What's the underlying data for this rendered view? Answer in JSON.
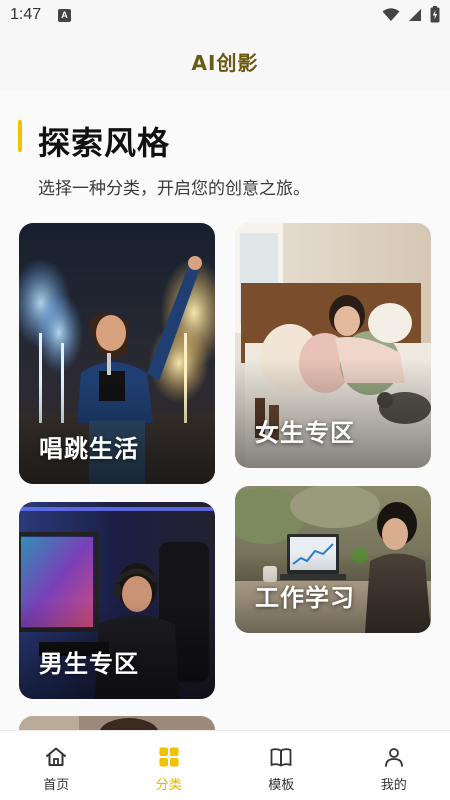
{
  "status": {
    "time": "1:47",
    "badge": "A"
  },
  "app": {
    "title": "AI创影"
  },
  "section": {
    "title": "探索风格",
    "subtitle": "选择一种分类，开启您的创意之旅。"
  },
  "categories": [
    {
      "label": "唱跳生活"
    },
    {
      "label": "女生专区"
    },
    {
      "label": "男生专区"
    },
    {
      "label": "工作学习"
    }
  ],
  "tabs": [
    {
      "label": "首页",
      "icon": "home-icon",
      "active": false
    },
    {
      "label": "分类",
      "icon": "grid-icon",
      "active": true
    },
    {
      "label": "模板",
      "icon": "book-icon",
      "active": false
    },
    {
      "label": "我的",
      "icon": "profile-icon",
      "active": false
    }
  ],
  "colors": {
    "accent": "#f2c200",
    "active_tab": "#e8b400",
    "title": "#6b5a12"
  }
}
